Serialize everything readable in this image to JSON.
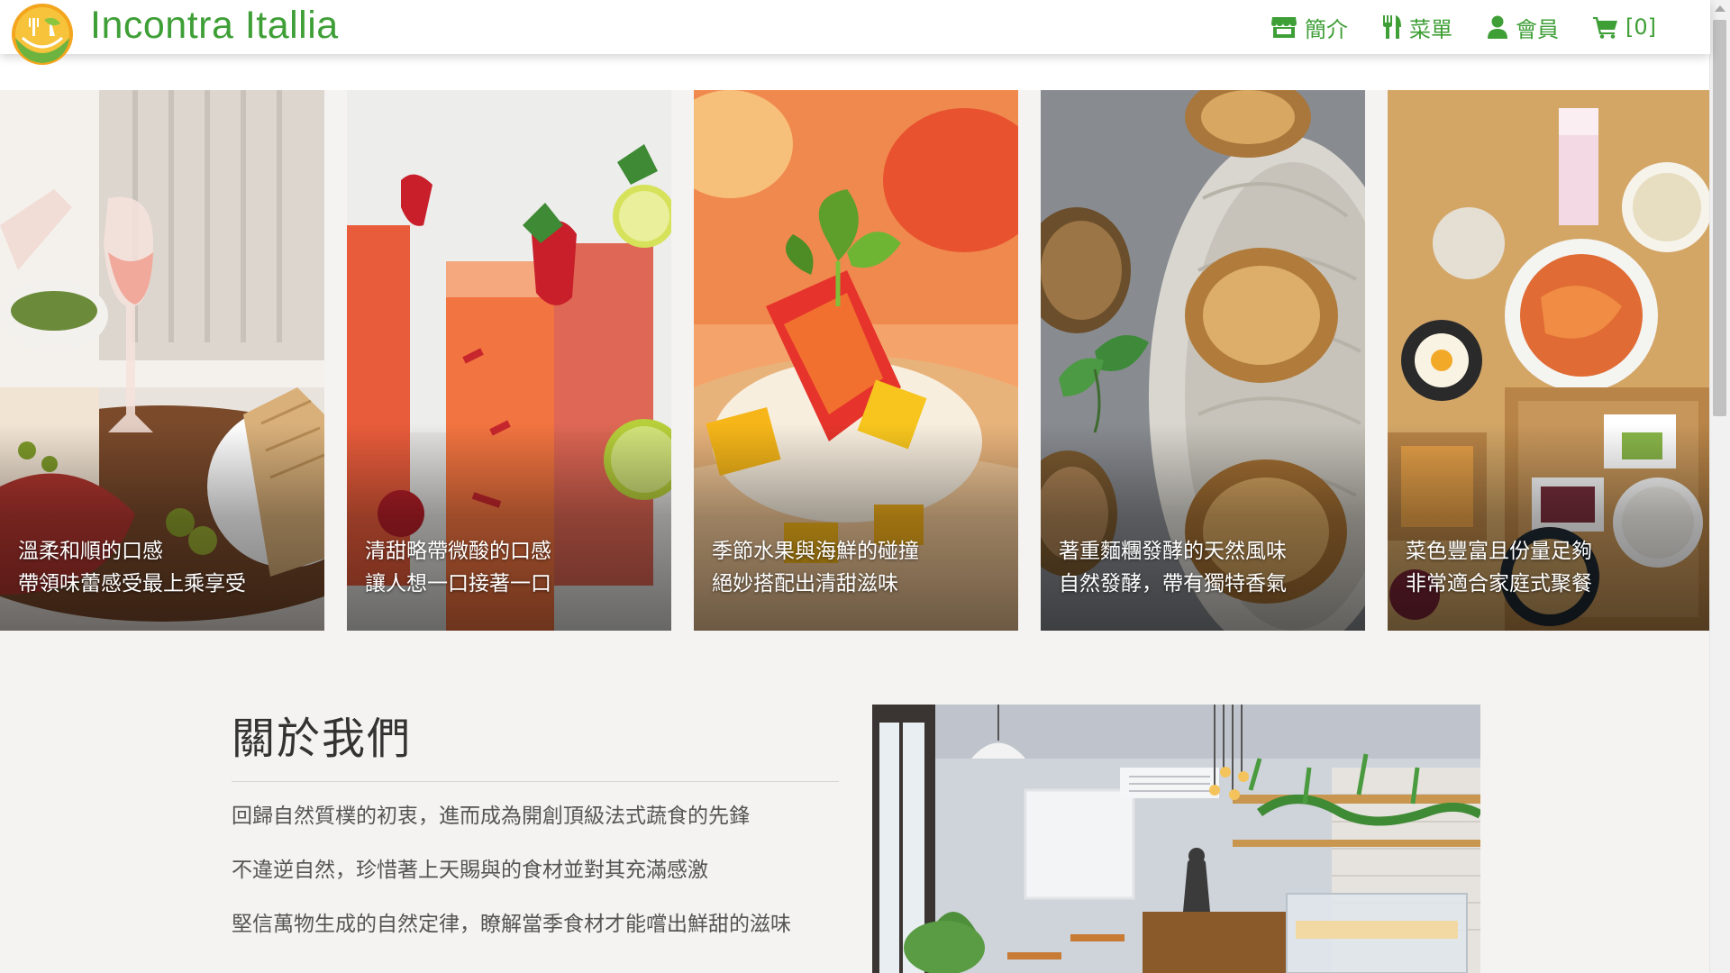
{
  "brand": {
    "name": "Incontra Itallia",
    "color": "#3f9f37"
  },
  "nav": {
    "items": [
      {
        "icon": "store-icon",
        "label": "簡介"
      },
      {
        "icon": "utensils-icon",
        "label": "菜單"
      },
      {
        "icon": "user-icon",
        "label": "會員"
      },
      {
        "icon": "cart-icon",
        "label": "[0]"
      }
    ]
  },
  "cards": [
    {
      "line1": "溫柔和順的口感",
      "line2": "帶領味蕾感受最上乘享受",
      "image": "wine-and-charcuterie-photo"
    },
    {
      "line1": "清甜略帶微酸的口感",
      "line2": "讓人想一口接著一口",
      "image": "strawberry-drinks-photo"
    },
    {
      "line1": "季節水果與海鮮的碰撞",
      "line2": "絕妙搭配出清甜滋味",
      "image": "fruit-seafood-tart-photo"
    },
    {
      "line1": "著重麵糰發酵的天然風味",
      "line2": "自然發酵，帶有獨特香氣",
      "image": "bread-basket-photo"
    },
    {
      "line1": "菜色豐富且份量足夠",
      "line2": "非常適合家庭式聚餐",
      "image": "family-meal-table-photo"
    }
  ],
  "about": {
    "title": "關於我們",
    "lines": [
      "回歸自然質樸的初衷，進而成為開創頂級法式蔬食的先鋒",
      "不違逆自然，珍惜著上天賜與的食材並對其充滿感激",
      "堅信萬物生成的自然定律，瞭解當季食材才能嚐出鮮甜的滋味"
    ],
    "image": "restaurant-interior-photo"
  }
}
